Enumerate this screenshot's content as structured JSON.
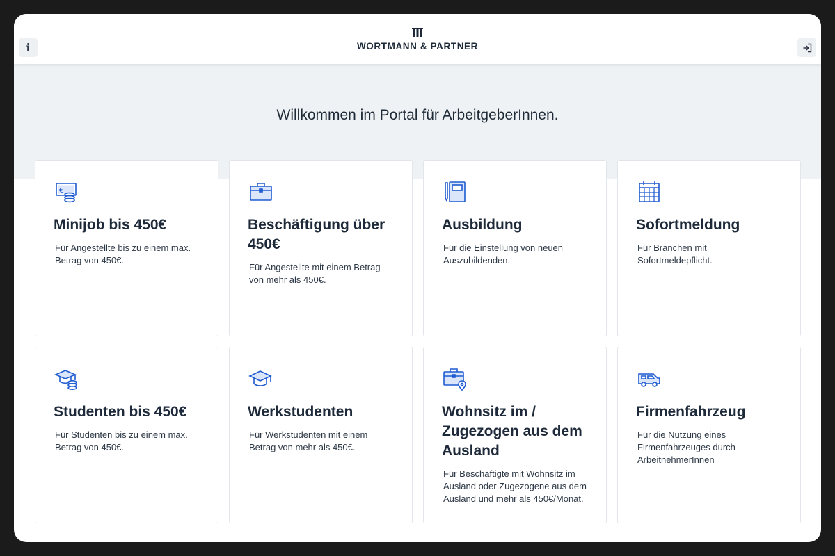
{
  "header": {
    "info_icon": "info-icon",
    "login_icon": "login-icon",
    "logo_mark": "logo-bars",
    "logo_text": "WORTMANN & PARTNER"
  },
  "hero": {
    "welcome": "Willkommen im Portal für ArbeitgeberInnen."
  },
  "accent_color": "#1f5bd1",
  "cards": [
    {
      "icon": "cash-coins-icon",
      "title": "Minijob bis 450€",
      "description": "Für Angestellte bis zu einem max. Betrag von 450€."
    },
    {
      "icon": "briefcase-icon",
      "title": "Beschäftigung über 450€",
      "description": "Für Angestellte mit einem Betrag von mehr als 450€."
    },
    {
      "icon": "notebook-pen-icon",
      "title": "Ausbildung",
      "description": "Für die Einstellung von neuen Auszubildenden."
    },
    {
      "icon": "calendar-icon",
      "title": "Sofortmeldung",
      "description": "Für Branchen mit Sofortmeldepflicht."
    },
    {
      "icon": "graduation-cap-coins-icon",
      "title": "Studenten bis 450€",
      "description": "Für Studenten bis zu einem max. Betrag von 450€."
    },
    {
      "icon": "graduation-cap-icon",
      "title": "Werkstudenten",
      "description": "Für Werkstudenten mit einem Betrag von mehr als 450€."
    },
    {
      "icon": "briefcase-location-icon",
      "title": "Wohnsitz im / Zugezogen aus dem Ausland",
      "description": "Für Beschäftigte mit Wohnsitz im Ausland oder Zugezogene aus dem Ausland und mehr als 450€/Monat."
    },
    {
      "icon": "car-icon",
      "title": "Firmenfahrzeug",
      "description": "Für die Nutzung eines Firmenfahrzeuges durch ArbeitnehmerInnen"
    }
  ]
}
